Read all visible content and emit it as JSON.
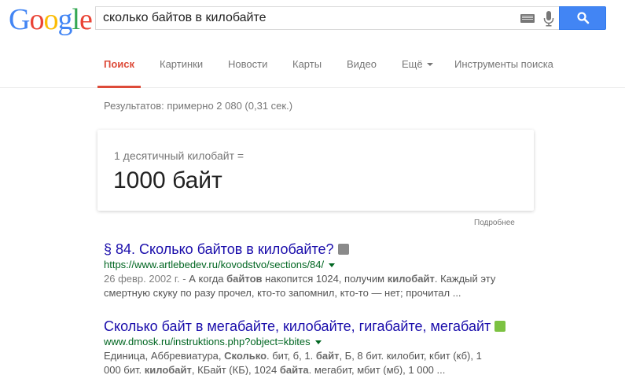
{
  "logo": {
    "text": "Google",
    "letters": [
      {
        "ch": "G",
        "color": "#4285f4"
      },
      {
        "ch": "o",
        "color": "#ea4335"
      },
      {
        "ch": "o",
        "color": "#fbbc05"
      },
      {
        "ch": "g",
        "color": "#4285f4"
      },
      {
        "ch": "l",
        "color": "#34a853"
      },
      {
        "ch": "e",
        "color": "#ea4335"
      }
    ]
  },
  "search": {
    "value": "сколько байтов в килобайте",
    "keyboard_icon": "keyboard-icon",
    "mic_icon": "microphone-icon",
    "button_icon": "search-icon"
  },
  "nav": {
    "tabs": [
      {
        "label": "Поиск",
        "active": true
      },
      {
        "label": "Картинки"
      },
      {
        "label": "Новости"
      },
      {
        "label": "Карты"
      },
      {
        "label": "Видео"
      },
      {
        "label": "Ещё"
      },
      {
        "label": "Инструменты поиска"
      }
    ],
    "accent": "#dd4b39"
  },
  "stats": "Результатов: примерно 2 080 (0,31 сек.)",
  "answer": {
    "label": "1 десятичный килобайт =",
    "value": "1000 байт",
    "more": "Подробнее"
  },
  "results": [
    {
      "title": "§ 84. Сколько байтов в килобайте?",
      "url": "https://www.artlebedev.ru/kovodstvo/sections/84/",
      "snippet_lines": [
        [
          {
            "t": "26 февр. 2002 г. - ",
            "s": "date"
          },
          {
            "t": "А когда "
          },
          {
            "t": "байтов",
            "s": "b"
          },
          {
            "t": " накопится 1024, получим "
          },
          {
            "t": "килобайт",
            "s": "b"
          },
          {
            "t": ". Каждый эту"
          }
        ],
        [
          {
            "t": "смертную скуку по разу прочел, кто-то запомнил, кто-то — нет; прочитал ..."
          }
        ]
      ],
      "favicon_color": "#8a8a8a"
    },
    {
      "title": "Сколько байт в мегабайте, килобайте, гигабайте, мегабайт",
      "url": "www.dmosk.ru/instruktions.php?object=kbites",
      "snippet_lines": [
        [
          {
            "t": "Единица, Аббревиатура, "
          },
          {
            "t": "Сколько",
            "s": "b"
          },
          {
            "t": ". бит, б, 1. "
          },
          {
            "t": "байт",
            "s": "b"
          },
          {
            "t": ", Б, 8 бит. килобит, кбит (кб), 1"
          }
        ],
        [
          {
            "t": "000 бит. "
          },
          {
            "t": "килобайт",
            "s": "b"
          },
          {
            "t": ", КБайт (КБ), 1024 "
          },
          {
            "t": "байта",
            "s": "b"
          },
          {
            "t": ". мегабит, мбит (мб), 1 000 ..."
          }
        ]
      ],
      "favicon_color": "#7cc242"
    }
  ]
}
